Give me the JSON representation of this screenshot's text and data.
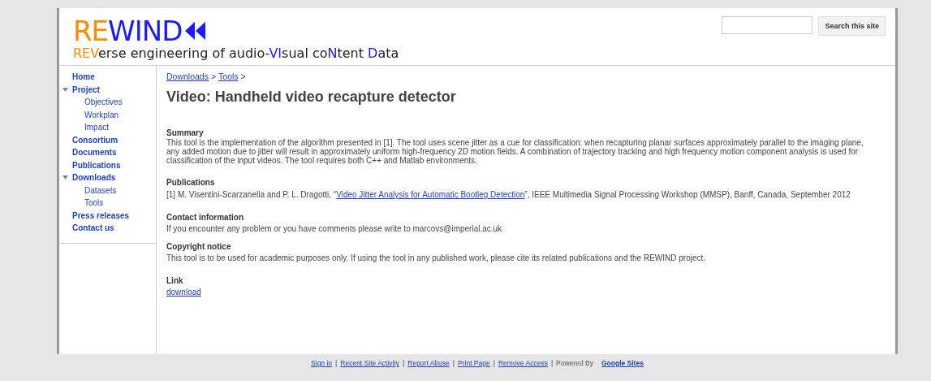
{
  "header": {
    "logo": [
      {
        "text": "RE",
        "color": "#ff8c00"
      },
      {
        "text": "WIND",
        "color": "#1a1aff"
      }
    ],
    "tagline": [
      {
        "text": "REV",
        "color": "#ff8c00"
      },
      {
        "text": "erse engineering of audio-",
        "color": "#222222"
      },
      {
        "text": "VI",
        "color": "#1a1aff"
      },
      {
        "text": "sual co",
        "color": "#222222"
      },
      {
        "text": "N",
        "color": "#1a1aff"
      },
      {
        "text": "tent ",
        "color": "#222222"
      },
      {
        "text": "D",
        "color": "#1a1aff"
      },
      {
        "text": "ata",
        "color": "#222222"
      }
    ],
    "search_button": "Search this site"
  },
  "sidebar": {
    "items": [
      {
        "label": "Home"
      },
      {
        "label": "Project",
        "expanded": true,
        "children": [
          {
            "label": "Objectives"
          },
          {
            "label": "Workplan"
          },
          {
            "label": "Impact"
          }
        ]
      },
      {
        "label": "Consortium"
      },
      {
        "label": "Documents"
      },
      {
        "label": "Publications"
      },
      {
        "label": "Downloads",
        "expanded": true,
        "children": [
          {
            "label": "Datasets"
          },
          {
            "label": "Tools"
          }
        ]
      },
      {
        "label": "Press releases"
      },
      {
        "label": "Contact us"
      }
    ]
  },
  "breadcrumb": [
    {
      "label": "Downloads",
      "separator": ">"
    },
    {
      "label": "Tools",
      "separator": ">"
    }
  ],
  "title": "Video: Handheld video recapture detector",
  "sections": [
    {
      "heading": "Summary",
      "kind": "text",
      "text": "This tool is the implementation of the algorithm presented in [1]. The tool uses scene jitter as a cue for classification: when recapturing planar surfaces approximately parallel to the imaging plane, any added motion due to jitter will result in approximately uniform high-frequency 2D motion fields. A combination of trajectory tracking and high frequency motion component analysis is used for classification of the input videos. The tool requires both C++ and Matlab environments."
    },
    {
      "heading": "Publications",
      "kind": "citation",
      "before": "[1] M. Visentini-Scarzanella and P. L. Dragotti, “",
      "link": "Video Jitter Analysis for Automatic Bootleg Detection",
      "after": "”, IEEE Multimedia Signal Processing Workshop (MMSP), Banff, Canada, September 2012"
    },
    {
      "heading": "Contact information",
      "kind": "text",
      "text": "If you encounter any problem or you have comments please write to marcovs@imperial.ac.uk"
    },
    {
      "heading": "Copyright notice",
      "kind": "text",
      "text": "This tool is to be used for academic purposes only. If using the tool in any published work, please cite its related publications and the REWIND project."
    },
    {
      "heading": "Link",
      "kind": "link",
      "link": "download"
    }
  ],
  "footer": {
    "links": [
      {
        "label": "Sign in",
        "separator": "|"
      },
      {
        "label": "Recent Site Activity",
        "separator": "|"
      },
      {
        "label": "Report Abuse",
        "separator": "|"
      },
      {
        "label": "Print Page",
        "separator": "|"
      },
      {
        "label": "Remove Access",
        "separator": "|"
      }
    ],
    "powered_by": "Powered By",
    "brand": "Google Sites"
  }
}
